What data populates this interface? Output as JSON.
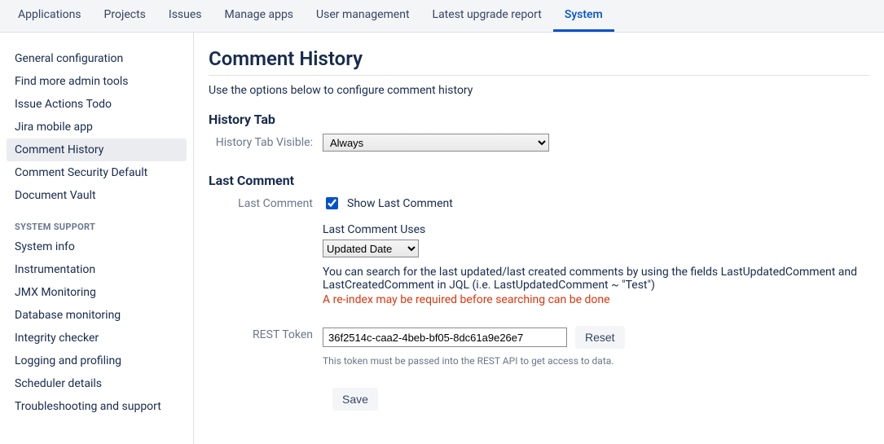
{
  "topnav": {
    "items": [
      {
        "label": "Applications"
      },
      {
        "label": "Projects"
      },
      {
        "label": "Issues"
      },
      {
        "label": "Manage apps"
      },
      {
        "label": "User management"
      },
      {
        "label": "Latest upgrade report"
      },
      {
        "label": "System",
        "active": true
      }
    ]
  },
  "sidebar": {
    "group1": [
      {
        "label": "General configuration"
      },
      {
        "label": "Find more admin tools"
      },
      {
        "label": "Issue Actions Todo"
      },
      {
        "label": "Jira mobile app"
      },
      {
        "label": "Comment History",
        "selected": true
      },
      {
        "label": "Comment Security Default"
      },
      {
        "label": "Document Vault"
      }
    ],
    "support_heading": "SYSTEM SUPPORT",
    "group2": [
      {
        "label": "System info"
      },
      {
        "label": "Instrumentation"
      },
      {
        "label": "JMX Monitoring"
      },
      {
        "label": "Database monitoring"
      },
      {
        "label": "Integrity checker"
      },
      {
        "label": "Logging and profiling"
      },
      {
        "label": "Scheduler details"
      },
      {
        "label": "Troubleshooting and support"
      }
    ]
  },
  "page": {
    "title": "Comment History",
    "subtitle": "Use the options below to configure comment history",
    "history_tab_heading": "History Tab",
    "history_tab_label": "History Tab Visible:",
    "history_tab_value": "Always",
    "last_comment_heading": "Last Comment",
    "last_comment_label": "Last Comment",
    "show_last_comment_checked": true,
    "show_last_comment_text": "Show Last Comment",
    "last_comment_uses_label": "Last Comment Uses",
    "last_comment_uses_value": "Updated Date",
    "jql_note": "You can search for the last updated/last created comments by using the fields LastUpdatedComment and LastCreatedComment in JQL (i.e. LastUpdatedComment ~ \"Test\")",
    "reindex_warning": "A re-index may be required before searching can be done",
    "rest_token_label": "REST Token",
    "rest_token_value": "36f2514c-caa2-4beb-bf05-8dc61a9e26e7",
    "reset_label": "Reset",
    "token_hint": "This token must be passed into the REST API to get access to data.",
    "save_label": "Save"
  }
}
